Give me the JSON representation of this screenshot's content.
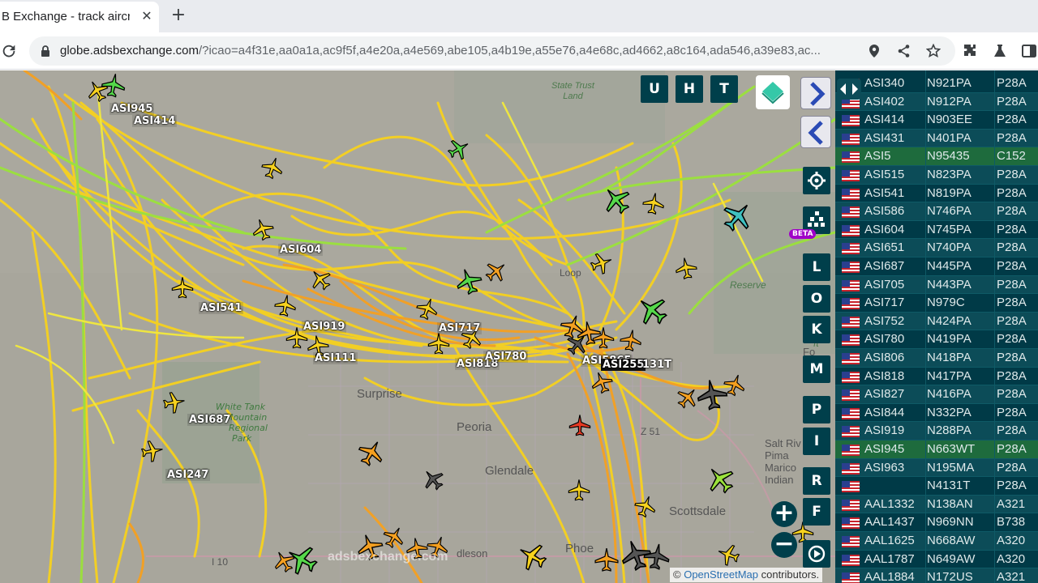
{
  "browser": {
    "tab_title": "B Exchange - track aircraft",
    "url_host": "globe.adsbexchange.com",
    "url_path": "/?icao=a4f31e,aa0a1a,ac9f5f,a4e20a,a4e569,abe105,a4b19e,a55e76,a4e68c,ad4662,a8c164,ada546,a39e83,ac..."
  },
  "map": {
    "buttons": {
      "u": "U",
      "h": "H",
      "t": "T"
    },
    "side_buttons": [
      "L",
      "O",
      "K",
      "M",
      "P",
      "I",
      "R",
      "F"
    ],
    "beta": "BETA",
    "watermark": "adsbexchange.com",
    "attribution_prefix": "©",
    "attribution_link": "OpenStreetMap",
    "attribution_suffix": " contributors.",
    "places": {
      "surprise": "Surprise",
      "peoria": "Peoria",
      "glendale": "Glendale",
      "scottsdale": "Scottsdale",
      "phoenix": "Phoe",
      "salt_river": "Salt Riv",
      "pima": "Pima",
      "marico": "Marico",
      "indian": "Indian",
      "fort_mcdowell": "Fo",
      "avondale": "dleson",
      "i10": "I 10",
      "az51": "Z 51",
      "reserve": "Reserve",
      "stacks": "ft",
      "loop": "Loop",
      "tree": "ree"
    },
    "park": [
      "White Tank",
      "Mountain",
      "Regional",
      "Park"
    ],
    "state_trust": [
      "State Trust",
      "Land"
    ],
    "labels": {
      "asi945": "ASI945",
      "asi414": "ASI414",
      "asi604": "ASI604",
      "asi541": "ASI541",
      "asi919": "ASI919",
      "asi111": "ASI111",
      "asi717": "ASI717",
      "asi818": "ASI818",
      "asi780": "ASI780",
      "asi5865": "ASI5865",
      "asi255": "ASI255",
      "n131t": "131T",
      "asi687": "ASI687",
      "asi247": "ASI247"
    }
  },
  "table": {
    "rows": [
      {
        "callsign": "ASI340",
        "reg": "N921PA",
        "type": "P28A",
        "selected": false
      },
      {
        "callsign": "ASI402",
        "reg": "N912PA",
        "type": "P28A",
        "selected": false
      },
      {
        "callsign": "ASI414",
        "reg": "N903EE",
        "type": "P28A",
        "selected": false
      },
      {
        "callsign": "ASI431",
        "reg": "N401PA",
        "type": "P28A",
        "selected": false
      },
      {
        "callsign": "ASI5",
        "reg": "N95435",
        "type": "C152",
        "selected": true
      },
      {
        "callsign": "ASI515",
        "reg": "N823PA",
        "type": "P28A",
        "selected": false
      },
      {
        "callsign": "ASI541",
        "reg": "N819PA",
        "type": "P28A",
        "selected": false
      },
      {
        "callsign": "ASI586",
        "reg": "N746PA",
        "type": "P28A",
        "selected": false
      },
      {
        "callsign": "ASI604",
        "reg": "N745PA",
        "type": "P28A",
        "selected": false
      },
      {
        "callsign": "ASI651",
        "reg": "N740PA",
        "type": "P28A",
        "selected": false
      },
      {
        "callsign": "ASI687",
        "reg": "N445PA",
        "type": "P28A",
        "selected": false
      },
      {
        "callsign": "ASI705",
        "reg": "N443PA",
        "type": "P28A",
        "selected": false
      },
      {
        "callsign": "ASI717",
        "reg": "N979C",
        "type": "P28A",
        "selected": false
      },
      {
        "callsign": "ASI752",
        "reg": "N424PA",
        "type": "P28A",
        "selected": false
      },
      {
        "callsign": "ASI780",
        "reg": "N419PA",
        "type": "P28A",
        "selected": false
      },
      {
        "callsign": "ASI806",
        "reg": "N418PA",
        "type": "P28A",
        "selected": false
      },
      {
        "callsign": "ASI818",
        "reg": "N417PA",
        "type": "P28A",
        "selected": false
      },
      {
        "callsign": "ASI827",
        "reg": "N416PA",
        "type": "P28A",
        "selected": false
      },
      {
        "callsign": "ASI844",
        "reg": "N332PA",
        "type": "P28A",
        "selected": false
      },
      {
        "callsign": "ASI919",
        "reg": "N288PA",
        "type": "P28A",
        "selected": false
      },
      {
        "callsign": "ASI945",
        "reg": "N663WT",
        "type": "P28A",
        "selected": true
      },
      {
        "callsign": "ASI963",
        "reg": "N195MA",
        "type": "P28A",
        "selected": false
      },
      {
        "callsign": "",
        "reg": "N4131T",
        "type": "P28A",
        "selected": false
      },
      {
        "callsign": "AAL1332",
        "reg": "N138AN",
        "type": "A321",
        "selected": false
      },
      {
        "callsign": "AAL1437",
        "reg": "N969NN",
        "type": "B738",
        "selected": false
      },
      {
        "callsign": "AAL1625",
        "reg": "N668AW",
        "type": "A320",
        "selected": false
      },
      {
        "callsign": "AAL1787",
        "reg": "N649AW",
        "type": "A320",
        "selected": false
      },
      {
        "callsign": "AAL1884",
        "reg": "N172US",
        "type": "A321",
        "selected": false
      }
    ]
  },
  "colors": {
    "map_bg": "#a9a79e",
    "track_yellow": "#f7d21e",
    "track_orange": "#f5a020",
    "track_green": "#8ee03a",
    "button_dark": "#003f4b",
    "table_bg": "#003a47",
    "selected_row": "#1e6b3d"
  },
  "icons": [
    "reload-icon",
    "lock-icon",
    "location-icon",
    "share-icon",
    "star-icon",
    "extensions-icon",
    "labs-icon",
    "sidepanel-icon",
    "settings-icon",
    "heatmap-icon",
    "layers-icon",
    "next-icon",
    "prev-icon",
    "zoom-in-icon",
    "zoom-out-icon",
    "replay-icon"
  ]
}
